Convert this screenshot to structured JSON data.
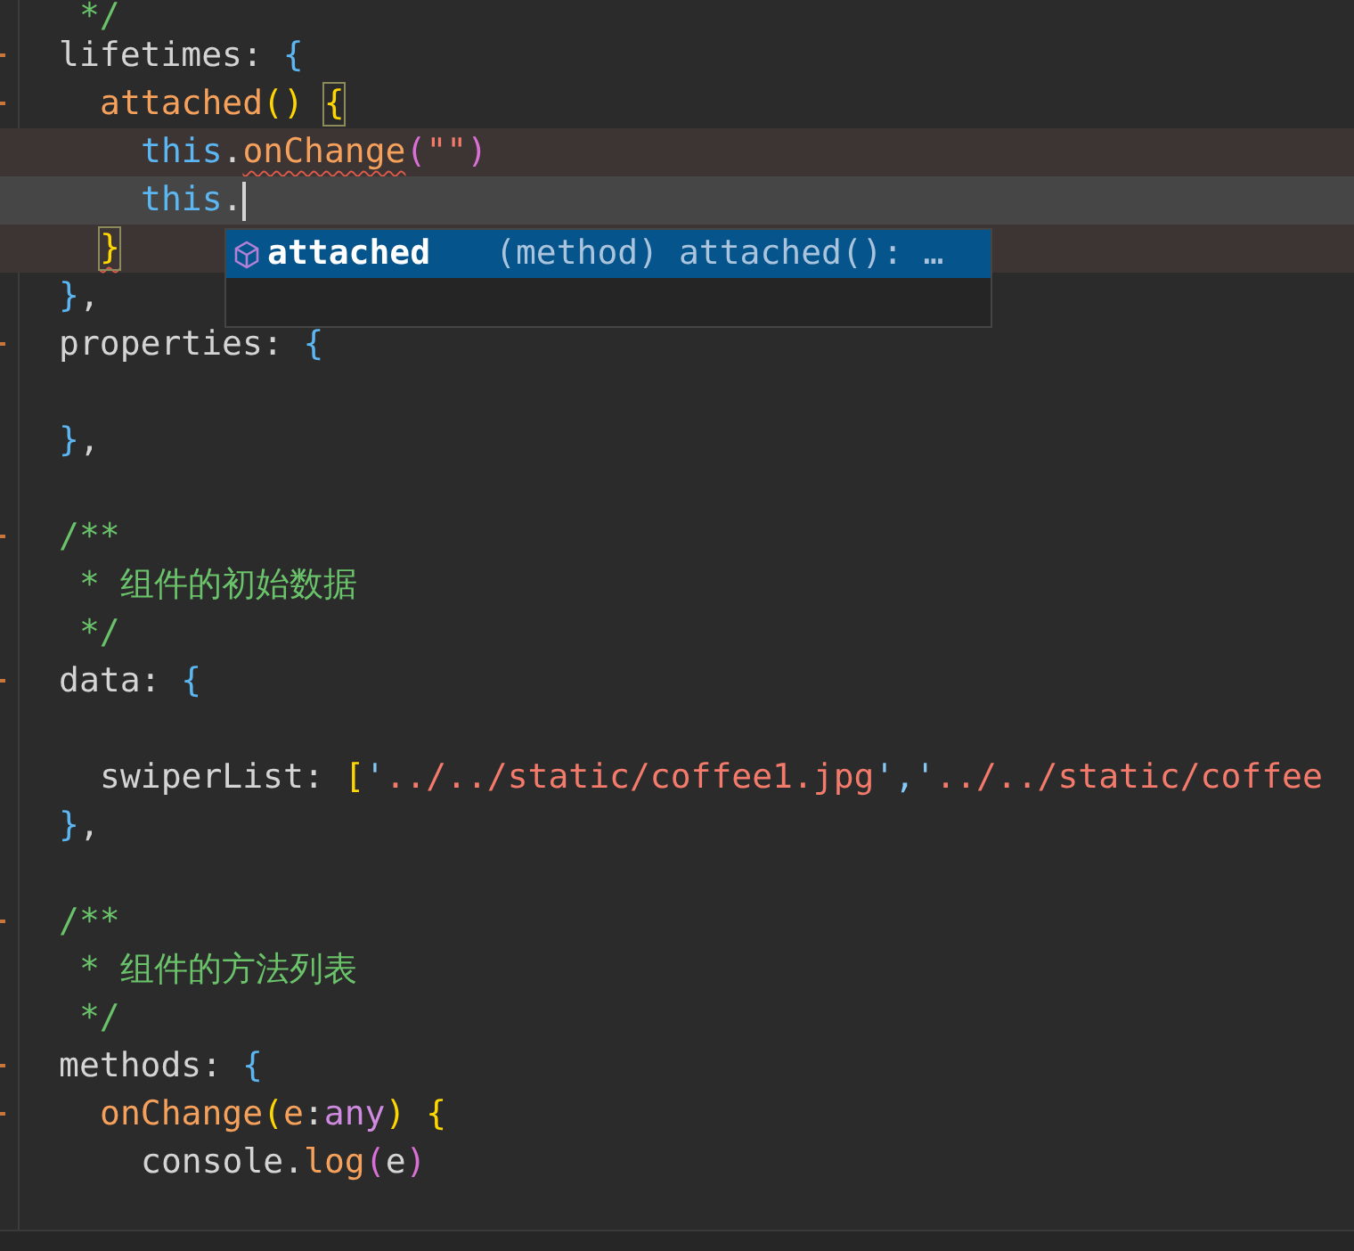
{
  "lines": [
    {
      "kind": "code",
      "tokens": [
        {
          "text": " */",
          "kind": "comment"
        }
      ]
    },
    {
      "kind": "code",
      "fold": true,
      "tokens": [
        {
          "text": "lifetimes",
          "kind": "text"
        },
        {
          "text": ": ",
          "kind": "text"
        },
        {
          "text": "{",
          "kind": "brace-blue"
        }
      ],
      "children": [
        {
          "kind": "code",
          "fold": true,
          "tokens": [
            {
              "text": "attached",
              "kind": "func"
            },
            {
              "text": "() ",
              "kind": "brace-yellow"
            },
            {
              "text": "{",
              "kind": "brace-yellow",
              "matched": true
            }
          ],
          "children": [
            {
              "kind": "code",
              "modified": true,
              "tokens": [
                {
                  "text": "this",
                  "kind": "keyword"
                },
                {
                  "text": ".",
                  "kind": "text"
                },
                {
                  "text": "onChange",
                  "kind": "func",
                  "error": true
                },
                {
                  "text": "(",
                  "kind": "brace-magenta"
                },
                {
                  "text": "\"\"",
                  "kind": "string"
                },
                {
                  "text": ")",
                  "kind": "brace-magenta"
                }
              ]
            },
            {
              "kind": "code",
              "current": true,
              "cursor": true,
              "tokens": [
                {
                  "text": "this",
                  "kind": "keyword"
                },
                {
                  "text": ".",
                  "kind": "text"
                }
              ]
            }
          ]
        },
        {
          "kind": "code",
          "modified": true,
          "tokens": [
            {
              "text": "}",
              "kind": "brace-yellow",
              "matched": true,
              "error": true
            }
          ]
        }
      ]
    },
    {
      "kind": "code",
      "tokens": [
        {
          "text": "}",
          "kind": "brace-blue"
        },
        {
          "text": ",",
          "kind": "text"
        }
      ]
    },
    {
      "kind": "code",
      "fold": true,
      "tokens": [
        {
          "text": "properties",
          "kind": "text"
        },
        {
          "text": ": ",
          "kind": "text"
        },
        {
          "text": "{",
          "kind": "brace-blue"
        }
      ]
    },
    {
      "kind": "blank"
    },
    {
      "kind": "code",
      "tokens": [
        {
          "text": "}",
          "kind": "brace-blue"
        },
        {
          "text": ",",
          "kind": "text"
        }
      ]
    },
    {
      "kind": "blank"
    },
    {
      "kind": "code",
      "fold": true,
      "tokens": [
        {
          "text": "/**",
          "kind": "comment"
        }
      ]
    },
    {
      "kind": "code",
      "tokens": [
        {
          "text": " * 组件的初始数据",
          "kind": "comment"
        }
      ]
    },
    {
      "kind": "code",
      "tokens": [
        {
          "text": " */",
          "kind": "comment"
        }
      ]
    },
    {
      "kind": "code",
      "fold": true,
      "tokens": [
        {
          "text": "data",
          "kind": "text"
        },
        {
          "text": ": ",
          "kind": "text"
        },
        {
          "text": "{",
          "kind": "brace-blue"
        }
      ],
      "children": [
        {
          "kind": "blank"
        },
        {
          "kind": "code",
          "tokens": [
            {
              "text": "swiperList",
              "kind": "text"
            },
            {
              "text": ": ",
              "kind": "text"
            },
            {
              "text": "[",
              "kind": "brace-yellow"
            },
            {
              "text": "'",
              "kind": "quote"
            },
            {
              "text": "../../static/coffee1.jpg",
              "kind": "string"
            },
            {
              "text": "','",
              "kind": "quote"
            },
            {
              "text": "../../static/coffee",
              "kind": "string"
            }
          ]
        }
      ]
    },
    {
      "kind": "code",
      "tokens": [
        {
          "text": "}",
          "kind": "brace-blue"
        },
        {
          "text": ",",
          "kind": "text"
        }
      ]
    },
    {
      "kind": "blank"
    },
    {
      "kind": "code",
      "fold": true,
      "tokens": [
        {
          "text": "/**",
          "kind": "comment"
        }
      ]
    },
    {
      "kind": "code",
      "tokens": [
        {
          "text": " * 组件的方法列表",
          "kind": "comment"
        }
      ]
    },
    {
      "kind": "code",
      "tokens": [
        {
          "text": " */",
          "kind": "comment"
        }
      ]
    },
    {
      "kind": "code",
      "fold": true,
      "tokens": [
        {
          "text": "methods",
          "kind": "text"
        },
        {
          "text": ": ",
          "kind": "text"
        },
        {
          "text": "{",
          "kind": "brace-blue"
        }
      ],
      "children": [
        {
          "kind": "code",
          "fold": true,
          "tokens": [
            {
              "text": "onChange",
              "kind": "func"
            },
            {
              "text": "(",
              "kind": "brace-yellow"
            },
            {
              "text": "e",
              "kind": "param"
            },
            {
              "text": ":",
              "kind": "text"
            },
            {
              "text": "any",
              "kind": "type"
            },
            {
              "text": ") ",
              "kind": "brace-yellow"
            },
            {
              "text": "{",
              "kind": "brace-yellow"
            }
          ],
          "children": [
            {
              "kind": "code",
              "tokens": [
                {
                  "text": "console",
                  "kind": "text"
                },
                {
                  "text": ".",
                  "kind": "text"
                },
                {
                  "text": "log",
                  "kind": "func"
                },
                {
                  "text": "(",
                  "kind": "brace-magenta"
                },
                {
                  "text": "e",
                  "kind": "text"
                },
                {
                  "text": ")",
                  "kind": "brace-magenta"
                }
              ]
            },
            {
              "kind": "blank"
            }
          ]
        }
      ]
    }
  ],
  "suggestions": [
    {
      "label": "attached",
      "detail": "(method) attached(): …",
      "selected": true
    }
  ]
}
